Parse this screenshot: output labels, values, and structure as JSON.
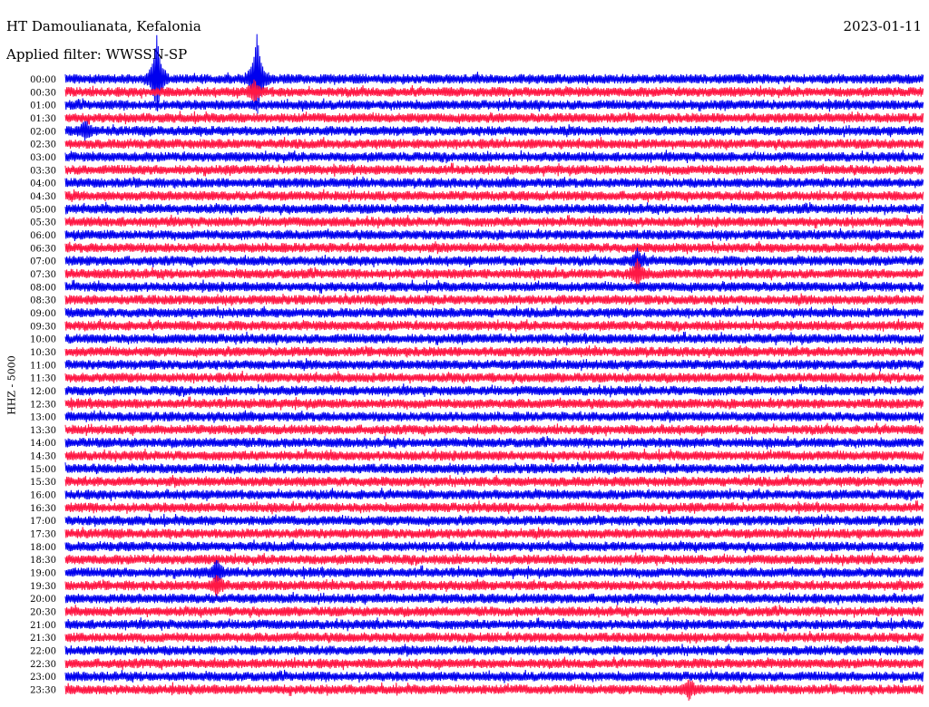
{
  "header": {
    "station": "HT Damoulianata, Kefalonia",
    "date": "2023-01-11",
    "filter": "Applied filter: WWSSN-SP"
  },
  "chart_data": {
    "type": "line",
    "title": "HT Damoulianata, Kefalonia",
    "subtitle": "Applied filter: WWSSN-SP",
    "date": "2023-01-11",
    "ylabel": "HHZ - 5000",
    "row_labels": [
      "00:00",
      "00:30",
      "01:00",
      "01:30",
      "02:00",
      "02:30",
      "03:00",
      "03:30",
      "04:00",
      "04:30",
      "05:00",
      "05:30",
      "06:00",
      "06:30",
      "07:00",
      "07:30",
      "08:00",
      "08:30",
      "09:00",
      "09:30",
      "10:00",
      "10:30",
      "11:00",
      "11:30",
      "12:00",
      "12:30",
      "13:00",
      "13:30",
      "14:00",
      "14:30",
      "15:00",
      "15:30",
      "16:00",
      "16:30",
      "17:00",
      "17:30",
      "18:00",
      "18:30",
      "19:00",
      "19:30",
      "20:00",
      "20:30",
      "21:00",
      "21:30",
      "22:00",
      "22:30",
      "23:00",
      "23:30"
    ],
    "trace_colors": [
      "#0000ee",
      "#ff1744"
    ],
    "grid": false,
    "events": [
      {
        "row": "00:00",
        "minute_offset": 3.2,
        "amplitude": 9.0
      },
      {
        "row": "00:00",
        "minute_offset": 6.7,
        "amplitude": 9.5
      },
      {
        "row": "00:30",
        "minute_offset": 6.6,
        "amplitude": 2.0
      },
      {
        "row": "02:00",
        "minute_offset": 0.7,
        "amplitude": 1.6
      },
      {
        "row": "07:00",
        "minute_offset": 20.0,
        "amplitude": 2.2
      },
      {
        "row": "07:30",
        "minute_offset": 20.0,
        "amplitude": 2.8
      },
      {
        "row": "19:00",
        "minute_offset": 5.3,
        "amplitude": 2.2
      },
      {
        "row": "19:30",
        "minute_offset": 5.3,
        "amplitude": 2.0
      },
      {
        "row": "23:30",
        "minute_offset": 21.8,
        "amplitude": 1.8
      }
    ]
  }
}
